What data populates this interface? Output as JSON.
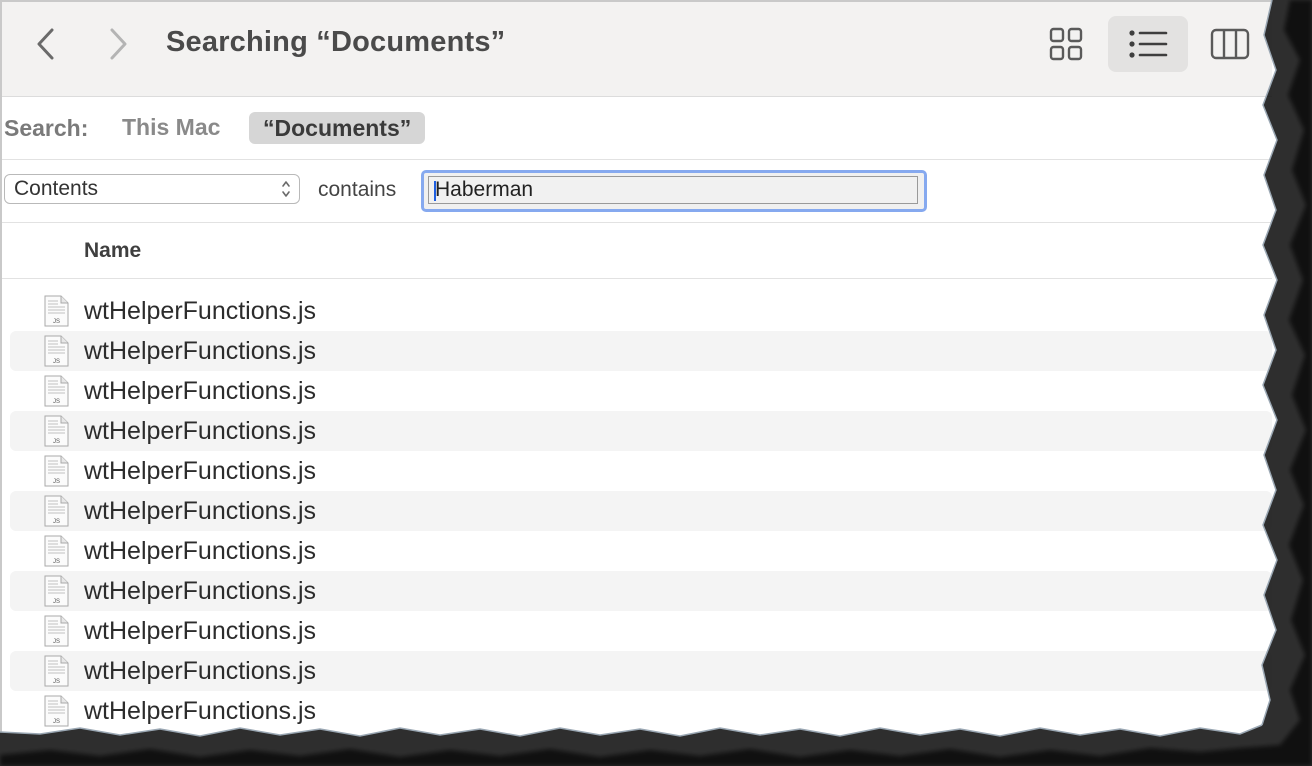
{
  "toolbar": {
    "title": "Searching “Documents”",
    "back_icon": "chevron-left-icon",
    "forward_icon": "chevron-right-icon",
    "views": [
      "icon-view-icon",
      "list-view-icon",
      "column-view-icon"
    ],
    "active_view": "list"
  },
  "search_scope": {
    "label": "Search:",
    "option_this_mac": "This Mac",
    "option_documents": "“Documents”"
  },
  "criteria": {
    "attribute": "Contents",
    "operator": "contains",
    "value": "Haberman"
  },
  "columns": {
    "name": "Name"
  },
  "files": [
    {
      "name": "wtHelperFunctions.js"
    },
    {
      "name": "wtHelperFunctions.js"
    },
    {
      "name": "wtHelperFunctions.js"
    },
    {
      "name": "wtHelperFunctions.js"
    },
    {
      "name": "wtHelperFunctions.js"
    },
    {
      "name": "wtHelperFunctions.js"
    },
    {
      "name": "wtHelperFunctions.js"
    },
    {
      "name": "wtHelperFunctions.js"
    },
    {
      "name": "wtHelperFunctions.js"
    },
    {
      "name": "wtHelperFunctions.js"
    },
    {
      "name": "wtHelperFunctions.js"
    }
  ],
  "file_icon_label": "JS",
  "colors": {
    "toolbar_bg": "#f3f2f1",
    "focus_ring": "#86a9ef",
    "scope_selected_bg": "#d6d6d6",
    "row_alt_bg": "#f4f4f4"
  }
}
